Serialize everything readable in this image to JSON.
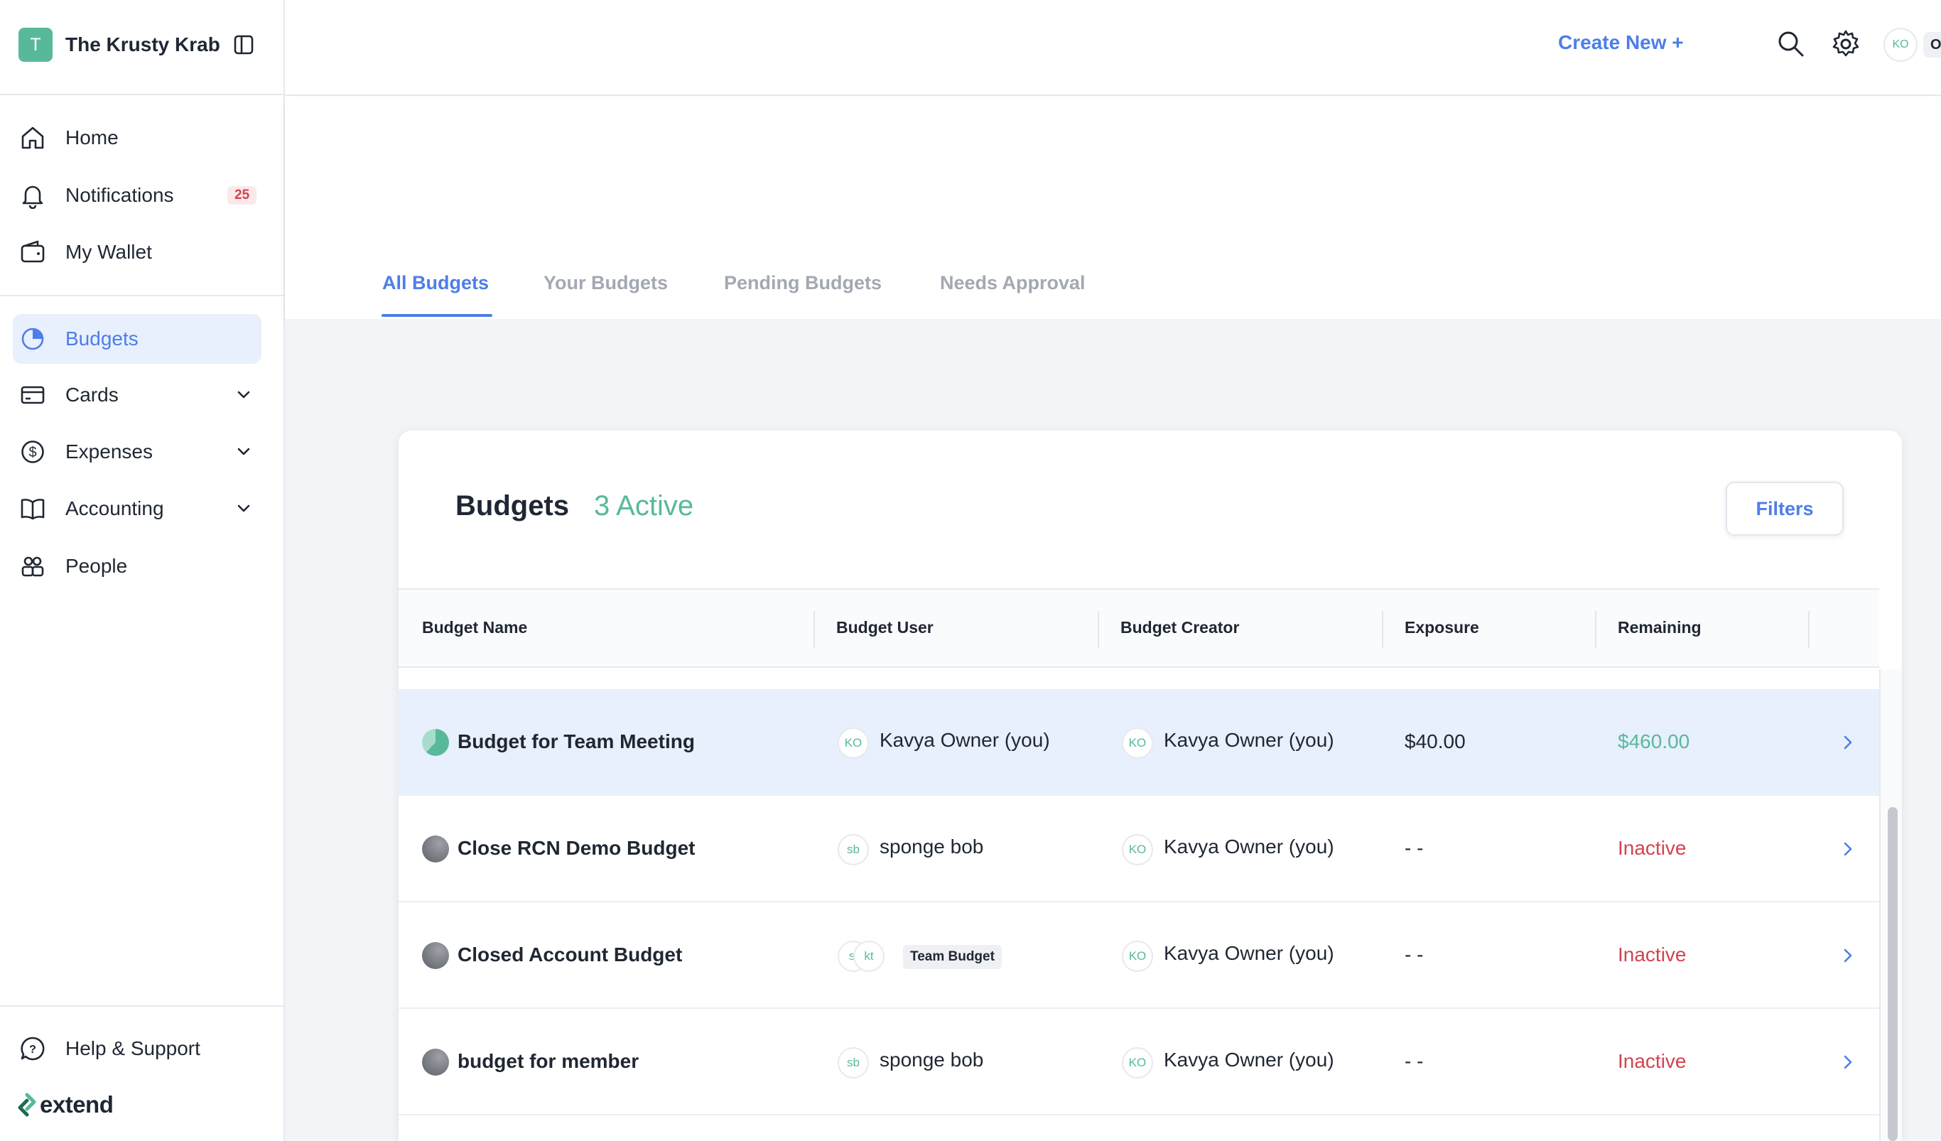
{
  "org": {
    "initial": "T",
    "name": "The Krusty Krab"
  },
  "nav": {
    "home": "Home",
    "notifications": "Notifications",
    "notifications_badge": "25",
    "wallet": "My Wallet",
    "budgets": "Budgets",
    "cards": "Cards",
    "expenses": "Expenses",
    "accounting": "Accounting",
    "people": "People",
    "help": "Help & Support"
  },
  "brand": "extend",
  "topbar": {
    "create_new": "Create New +",
    "user_initials": "KO",
    "user_tag": "O"
  },
  "tabs": [
    "All Budgets",
    "Your Budgets",
    "Pending Budgets",
    "Needs Approval"
  ],
  "active_tab": "All Budgets",
  "card": {
    "title": "Budgets",
    "count": "3 Active",
    "filters": "Filters"
  },
  "table": {
    "headers": [
      "Budget Name",
      "Budget User",
      "Budget Creator",
      "Exposure",
      "Remaining"
    ],
    "rows": [
      {
        "name": "Budget for Team Meeting",
        "status": "active",
        "user_initials": [
          "KO"
        ],
        "user": "Kavya Owner (you)",
        "creator_initials": "KO",
        "creator": "Kavya Owner (you)",
        "exposure": "$40.00",
        "remaining": "$460.00"
      },
      {
        "name": "Close RCN Demo Budget",
        "status": "inactive",
        "user_initials": [
          "sb"
        ],
        "user": "sponge bob",
        "creator_initials": "KO",
        "creator": "Kavya Owner (you)",
        "exposure": "- -",
        "remaining": "Inactive"
      },
      {
        "name": "Closed Account Budget",
        "status": "inactive",
        "user_initials": [
          "sl",
          "kt"
        ],
        "user_tag": "Team Budget",
        "creator_initials": "KO",
        "creator": "Kavya Owner (you)",
        "exposure": "- -",
        "remaining": "Inactive"
      },
      {
        "name": "budget for member",
        "status": "inactive",
        "user_initials": [
          "sb"
        ],
        "user": "sponge bob",
        "creator_initials": "KO",
        "creator": "Kavya Owner (you)",
        "exposure": "- -",
        "remaining": "Inactive"
      }
    ]
  },
  "colors": {
    "accent": "#4d7ee8",
    "positive": "#58b99a",
    "negative": "#d3434f",
    "selected_row": "#e8effd"
  }
}
